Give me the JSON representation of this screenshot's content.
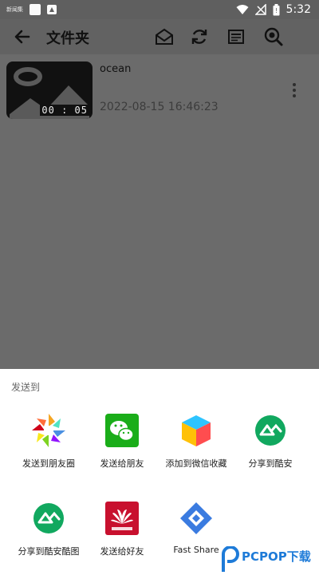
{
  "status_bar": {
    "carrier": "新闻集",
    "time": "5:32",
    "icons": [
      "app-notification-icon",
      "photo-notification-icon",
      "wifi-icon",
      "no-signal-icon",
      "battery-icon"
    ]
  },
  "toolbar": {
    "title": "文件夹",
    "icons": [
      "back-arrow-icon",
      "mail-icon",
      "refresh-icon",
      "note-icon",
      "search-icon"
    ]
  },
  "files": [
    {
      "name": "ocean",
      "duration": "00 : 05",
      "date": "2022-08-15 16:46:23"
    }
  ],
  "share_sheet": {
    "header": "发送到",
    "apps": [
      {
        "label": "发送到朋友圈",
        "icon": "wechat-moments-icon"
      },
      {
        "label": "发送给朋友",
        "icon": "wechat-icon"
      },
      {
        "label": "添加到微信收藏",
        "icon": "wechat-favorites-icon"
      },
      {
        "label": "分享到酷安",
        "icon": "coolapk-icon"
      },
      {
        "label": "分享到酷安酷图",
        "icon": "coolapk-image-icon"
      },
      {
        "label": "发送给好友",
        "icon": "huawei-icon"
      },
      {
        "label": "Fast Share",
        "icon": "fast-share-icon"
      }
    ]
  },
  "watermark": {
    "text": "PCPOP下载"
  },
  "colors": {
    "dim_overlay": "#6a6a6a",
    "wechat_green": "#1aad19",
    "coolapk_green": "#11a85f",
    "huawei_red": "#c8102e",
    "fast_share_blue": "#3a7be0"
  }
}
